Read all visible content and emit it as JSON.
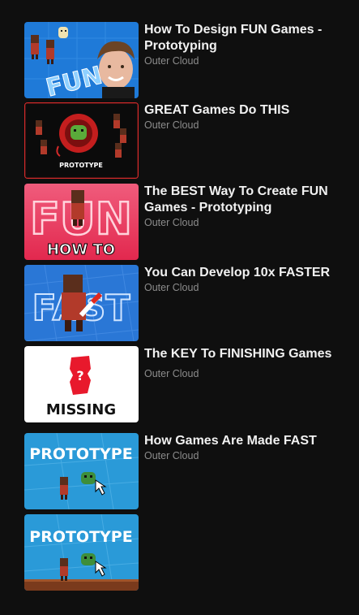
{
  "videos": [
    {
      "title": "How To Design FUN Games - Prototyping",
      "channel": "Outer Cloud",
      "thumbnail": {
        "overlay_text": "FUN",
        "bg": "#1f7ad8"
      }
    },
    {
      "title": "GREAT Games Do THIS",
      "channel": "Outer Cloud",
      "thumbnail": {
        "overlay_text": "PROTOTYPE",
        "bg": "#0b0b0b",
        "border": "#d42a2a"
      }
    },
    {
      "title": "The BEST Way To Create FUN Games - Prototyping",
      "channel": "Outer Cloud",
      "thumbnail": {
        "overlay_text_big": "FUN",
        "overlay_text_small": "HOW TO",
        "bg": "#ea3c64"
      }
    },
    {
      "title": "You Can Develop 10x FASTER",
      "channel": "Outer Cloud",
      "thumbnail": {
        "overlay_text": "FAST",
        "bg": "#2a77d6"
      }
    },
    {
      "title": "The KEY To FINISHING Games",
      "channel": "Outer Cloud",
      "thumbnail": {
        "overlay_text": "MISSING",
        "bg": "#ffffff",
        "accent": "#e8192c",
        "glyph": "?"
      }
    },
    {
      "title": "How Games Are Made FAST",
      "channel": "Outer Cloud",
      "thumbnail": {
        "overlay_text": "PROTOTYPE",
        "bg": "#2a9ad8"
      }
    },
    {
      "title": "",
      "channel": "",
      "thumbnail": {
        "overlay_text": "PROTOTYPE",
        "bg": "#2a9ad8",
        "ground": "#7a3a1c"
      }
    }
  ]
}
